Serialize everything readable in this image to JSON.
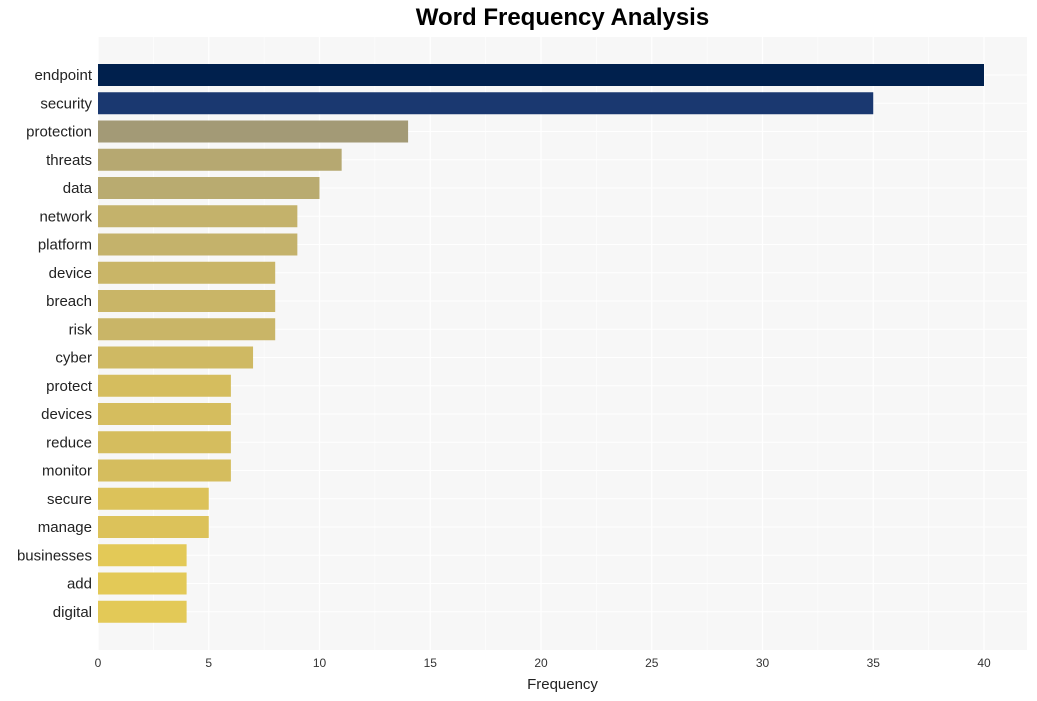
{
  "chart_data": {
    "type": "bar",
    "orientation": "horizontal",
    "title": "Word Frequency Analysis",
    "xlabel": "Frequency",
    "ylabel": "",
    "xlim": [
      0,
      42
    ],
    "xticks": [
      0,
      5,
      10,
      15,
      20,
      25,
      30,
      35,
      40
    ],
    "grid": true,
    "legend": "none",
    "categories": [
      "endpoint",
      "security",
      "protection",
      "threats",
      "data",
      "network",
      "platform",
      "device",
      "breach",
      "risk",
      "cyber",
      "protect",
      "devices",
      "reduce",
      "monitor",
      "secure",
      "manage",
      "businesses",
      "add",
      "digital"
    ],
    "values": [
      40,
      35,
      14,
      11,
      10,
      9,
      9,
      8,
      8,
      8,
      7,
      6,
      6,
      6,
      6,
      5,
      5,
      4,
      4,
      4
    ],
    "colors": [
      "#00204d",
      "#1a3870",
      "#a39a76",
      "#b6a871",
      "#b9ab70",
      "#c4b26b",
      "#c4b26b",
      "#c9b567",
      "#c9b567",
      "#c9b567",
      "#cfb963",
      "#d5bd5e",
      "#d5bd5e",
      "#d5bd5e",
      "#d5bd5e",
      "#dcc25a",
      "#dcc25a",
      "#e3c957",
      "#e3c957",
      "#e3c957"
    ]
  }
}
